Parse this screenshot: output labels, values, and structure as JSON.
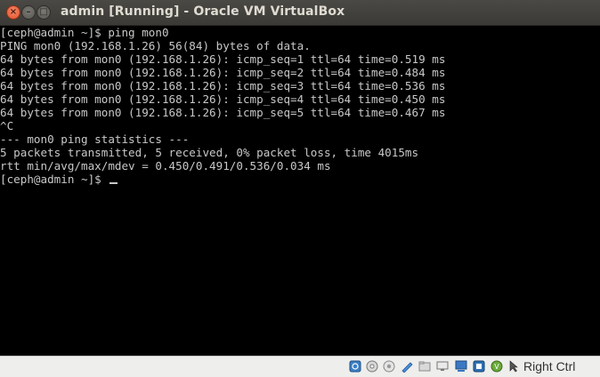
{
  "window": {
    "title": "admin [Running] - Oracle VM VirtualBox"
  },
  "terminal": {
    "lines": [
      "[ceph@admin ~]$ ping mon0",
      "PING mon0 (192.168.1.26) 56(84) bytes of data.",
      "64 bytes from mon0 (192.168.1.26): icmp_seq=1 ttl=64 time=0.519 ms",
      "64 bytes from mon0 (192.168.1.26): icmp_seq=2 ttl=64 time=0.484 ms",
      "64 bytes from mon0 (192.168.1.26): icmp_seq=3 ttl=64 time=0.536 ms",
      "64 bytes from mon0 (192.168.1.26): icmp_seq=4 ttl=64 time=0.450 ms",
      "64 bytes from mon0 (192.168.1.26): icmp_seq=5 ttl=64 time=0.467 ms",
      "^C",
      "--- mon0 ping statistics ---",
      "5 packets transmitted, 5 received, 0% packet loss, time 4015ms",
      "rtt min/avg/max/mdev = 0.450/0.491/0.536/0.034 ms"
    ],
    "prompt": "[ceph@admin ~]$ "
  },
  "statusbar": {
    "icons": [
      "hard-disk-icon",
      "optical-drive-icon",
      "audio-icon",
      "usb-icon",
      "shared-folders-icon",
      "display-icon",
      "network-icon",
      "video-capture-icon",
      "cpu-icon",
      "mouse-integration-icon"
    ],
    "host_key": "Right Ctrl"
  }
}
